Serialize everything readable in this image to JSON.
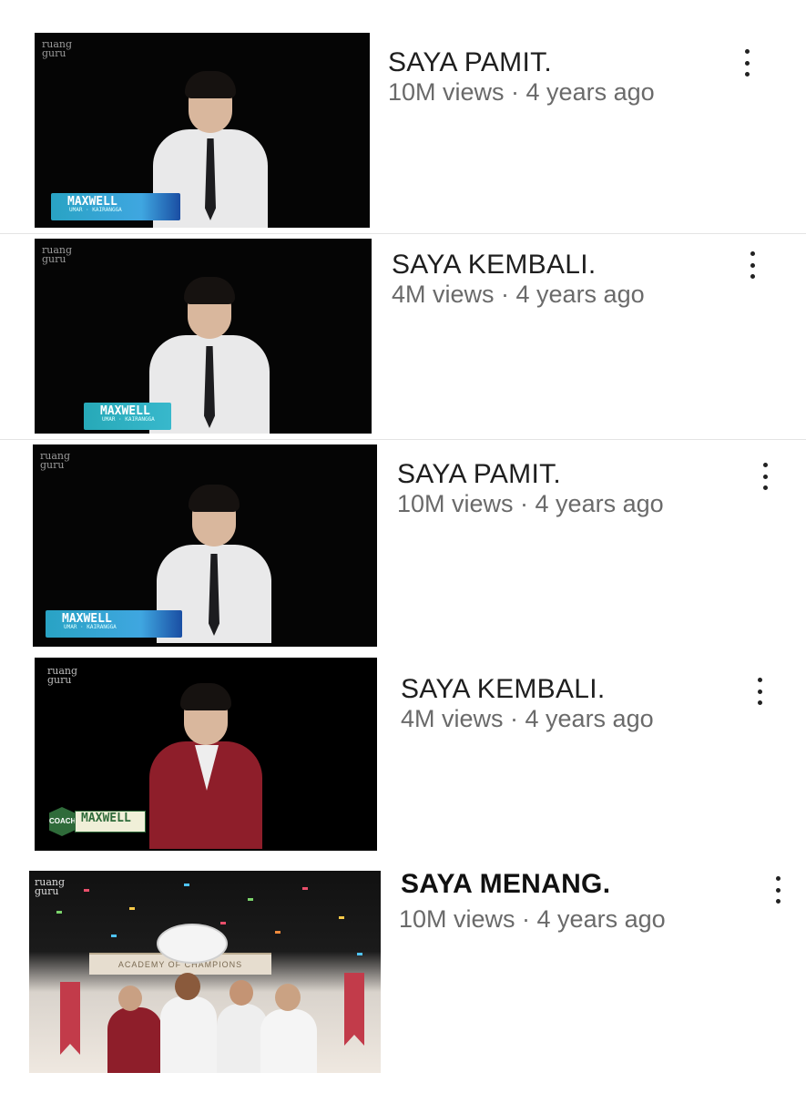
{
  "videos": [
    {
      "title": "SAYA PAMIT.",
      "meta": "10M views · 4 years ago",
      "channel_logo": "ruang guru",
      "name_tag": "MAXWELL"
    },
    {
      "title": "SAYA KEMBALI.",
      "meta": "4M views · 4 years ago",
      "channel_logo": "ruang guru",
      "name_tag": "MAXWELL"
    },
    {
      "title": "SAYA PAMIT.",
      "meta": "10M views · 4 years ago",
      "channel_logo": "ruang guru",
      "name_tag": "MAXWELL"
    },
    {
      "title": "SAYA KEMBALI.",
      "meta": "4M views · 4 years ago",
      "channel_logo": "ruang guru",
      "name_tag": "MAXWELL",
      "badge": "COACH"
    },
    {
      "title": "SAYA MENANG.",
      "meta": "10M views · 4 years ago",
      "channel_logo": "ruang guru",
      "banner": "ACADEMY OF CHAMPIONS"
    }
  ],
  "icons": {
    "more": "vertical-ellipsis-icon"
  },
  "colors": {
    "title": "#1f1f1f",
    "meta": "#6a6a6a",
    "thumbnail_bg": "#050505",
    "blazer": "#8e1e2a",
    "tag_blue": "#3fa6e0",
    "tag_green": "#2f6b3a"
  }
}
